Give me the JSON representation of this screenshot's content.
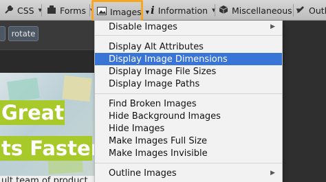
{
  "toolbar": {
    "items": [
      {
        "label": "CSS",
        "icon": "css-wrench-icon"
      },
      {
        "label": "Forms",
        "icon": "forms-icon"
      },
      {
        "label": "Images",
        "icon": "image-icon"
      },
      {
        "label": "Information",
        "icon": "info-icon"
      },
      {
        "label": "Miscellaneous",
        "icon": "cube-icon"
      },
      {
        "label": "Outl",
        "icon": "pencil-icon"
      }
    ]
  },
  "page": {
    "buttons": [
      "rotate"
    ],
    "headline_1": "Great",
    "headline_2": "ts Faster",
    "subtext": "ult team of product"
  },
  "menu": {
    "accent": "#3875d7",
    "highlight": "#f5a623",
    "items": [
      {
        "label": "Disable Images",
        "submenu": true
      },
      {
        "label": "Display Alt Attributes",
        "submenu": false
      },
      {
        "label": "Display Image Dimensions",
        "submenu": false,
        "selected": true
      },
      {
        "label": "Display Image File Sizes",
        "submenu": false
      },
      {
        "label": "Display Image Paths",
        "submenu": false
      },
      {
        "label": "Find Broken Images",
        "submenu": false
      },
      {
        "label": "Hide Background Images",
        "submenu": false
      },
      {
        "label": "Hide Images",
        "submenu": false
      },
      {
        "label": "Make Images Full Size",
        "submenu": false
      },
      {
        "label": "Make Images Invisible",
        "submenu": false
      },
      {
        "label": "Outline Images",
        "submenu": true
      }
    ]
  }
}
